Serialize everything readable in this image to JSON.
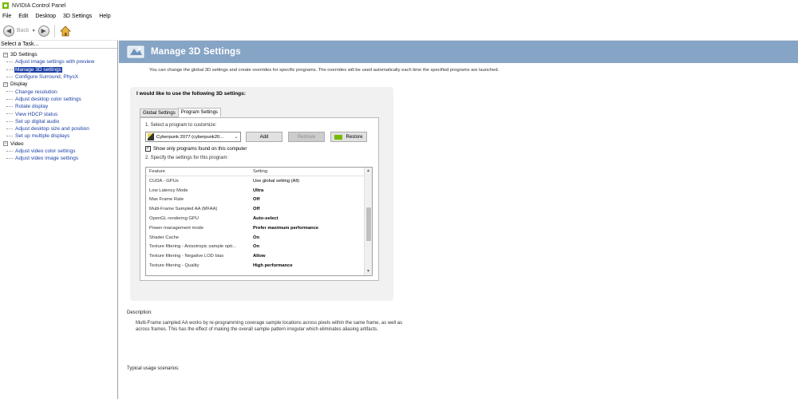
{
  "window": {
    "title": "NVIDIA Control Panel"
  },
  "menu": [
    "File",
    "Edit",
    "Desktop",
    "3D Settings",
    "Help"
  ],
  "toolbar": {
    "back_label": "Back"
  },
  "sidebar": {
    "title": "Select a Task...",
    "categories": [
      {
        "label": "3D Settings",
        "items": [
          "Adjust image settings with preview",
          "Manage 3D settings",
          "Configure Surround, PhysX"
        ]
      },
      {
        "label": "Display",
        "items": [
          "Change resolution",
          "Adjust desktop color settings",
          "Rotate display",
          "View HDCP status",
          "Set up digital audio",
          "Adjust desktop size and position",
          "Set up multiple displays"
        ]
      },
      {
        "label": "Video",
        "items": [
          "Adjust video color settings",
          "Adjust video image settings"
        ]
      }
    ],
    "selected": "Manage 3D settings"
  },
  "main": {
    "title": "Manage 3D Settings",
    "intro": "You can change the global 3D settings and create overrides for specific programs. The overrides will be used automatically each time the specified programs are launched.",
    "heading": "I would like to use the following 3D settings:",
    "tabs": [
      "Global Settings",
      "Program Settings"
    ],
    "active_tab": "Program Settings",
    "step1": "1. Select a program to customize:",
    "program": "Cyberpunk 2077 (cyberpunk20...",
    "add_button": "Add",
    "remove_button": "Remove",
    "restore_button": "Restore",
    "show_only_label": "Show only programs found on this computer",
    "show_only_checked": "✓",
    "step2": "2. Specify the settings for this program:",
    "table_headers": {
      "feature": "Feature",
      "setting": "Setting"
    },
    "rows": [
      {
        "feature": "CUDA - GPUs",
        "setting": "Use global setting (All)"
      },
      {
        "feature": "Low Latency Mode",
        "setting": "Ultra"
      },
      {
        "feature": "Max Frame Rate",
        "setting": "Off"
      },
      {
        "feature": "Multi-Frame Sampled AA (MFAA)",
        "setting": "Off"
      },
      {
        "feature": "OpenGL rendering GPU",
        "setting": "Auto-select"
      },
      {
        "feature": "Power management mode",
        "setting": "Prefer maximum performance"
      },
      {
        "feature": "Shader Cache",
        "setting": "On"
      },
      {
        "feature": "Texture filtering - Anisotropic sample opti...",
        "setting": "On"
      },
      {
        "feature": "Texture filtering - Negative LOD bias",
        "setting": "Allow"
      },
      {
        "feature": "Texture filtering - Quality",
        "setting": "High performance"
      }
    ],
    "description_label": "Description:",
    "description": "Multi-Frame sampled AA works by re-programming coverage sample locations across pixels within the same frame, as well as across frames. This has the effect of making the overall sample pattern irregular which eliminates aliasing artifacts.",
    "usage_label": "Typical usage scenarios:"
  }
}
